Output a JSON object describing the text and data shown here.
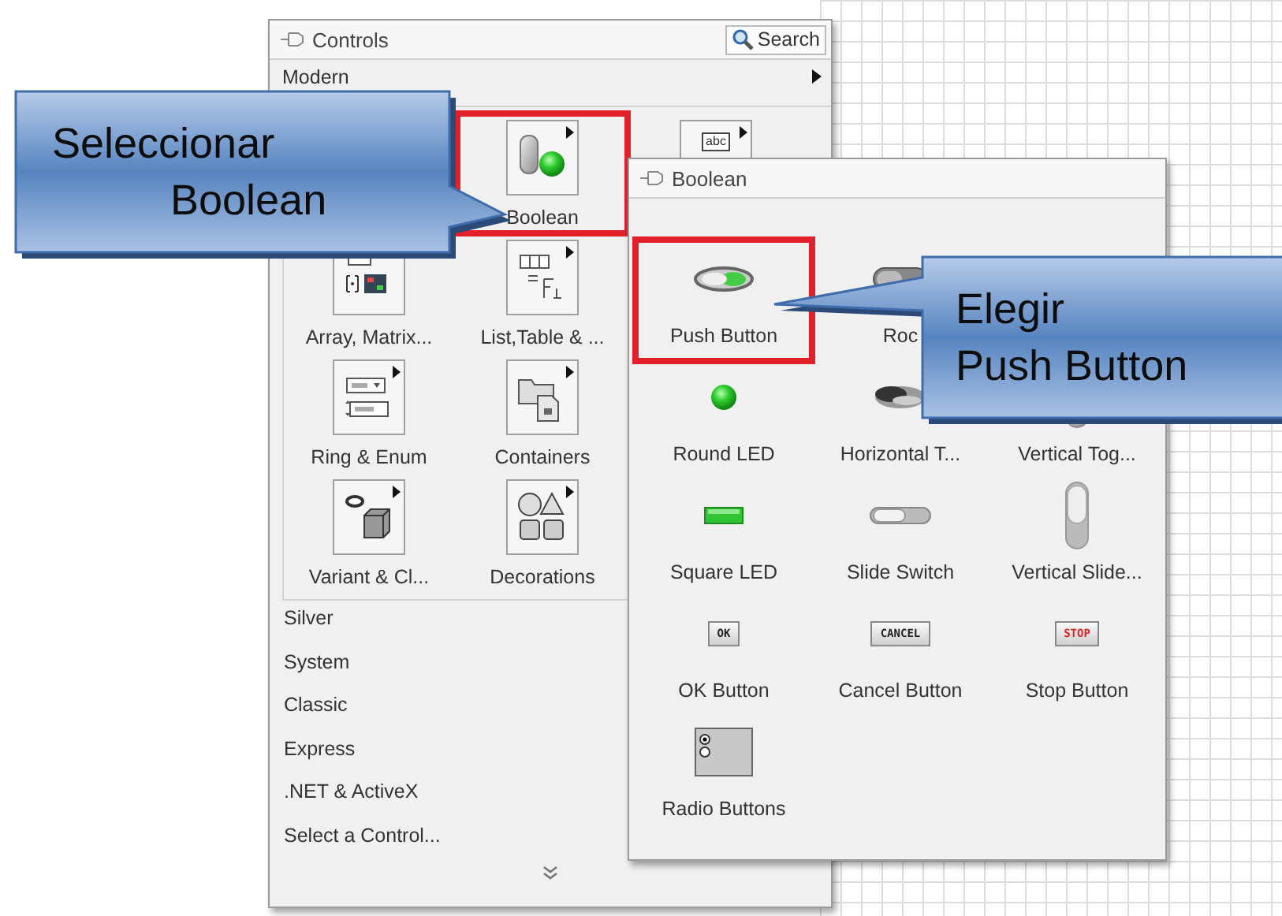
{
  "controls_palette": {
    "title": "Controls",
    "search_button": "Search",
    "category": "Modern",
    "rows": [
      [
        "",
        {
          "kind": "boolean",
          "label": "Boolean",
          "highlighted": true
        },
        {
          "kind": "string",
          "icon_text": "abc",
          "highlighted": false
        }
      ],
      [
        {
          "kind": "array",
          "label": "Array, Matrix...",
          "highlighted": false
        },
        {
          "kind": "list_table",
          "label": "List,Table & ...",
          "highlighted": false
        }
      ],
      [
        {
          "kind": "ring_enum",
          "label": "Ring & Enum",
          "highlighted": false
        },
        {
          "kind": "containers",
          "label": "Containers",
          "highlighted": false
        }
      ],
      [
        {
          "kind": "variant_class",
          "label": "Variant & Cl...",
          "highlighted": false
        },
        {
          "kind": "decorations",
          "label": "Decorations",
          "highlighted": false
        }
      ]
    ],
    "categories": [
      "Silver",
      "System",
      "Classic",
      "Express",
      ".NET & ActiveX",
      "Select a Control..."
    ]
  },
  "boolean_palette": {
    "title": "Boolean",
    "rows": [
      [
        {
          "kind": "push_button",
          "label": "Push Button",
          "highlighted": true
        },
        {
          "kind": "rocker",
          "label": "Roc",
          "highlighted": false
        }
      ],
      [
        {
          "kind": "round_led",
          "label": "Round LED",
          "highlighted": false
        },
        {
          "kind": "horizontal_toggle",
          "label": "Horizontal T...",
          "highlighted": false
        },
        {
          "kind": "vertical_toggle",
          "label": "Vertical Tog...",
          "highlighted": false
        }
      ],
      [
        {
          "kind": "square_led",
          "label": "Square LED",
          "highlighted": false
        },
        {
          "kind": "slide_switch",
          "label": "Slide Switch",
          "highlighted": false
        },
        {
          "kind": "vertical_slide",
          "label": "Vertical Slide...",
          "highlighted": false
        }
      ],
      [
        {
          "kind": "ok_button",
          "icon_text": "OK",
          "label": "OK Button",
          "highlighted": false
        },
        {
          "kind": "cancel_button",
          "icon_text": "CANCEL",
          "label": "Cancel Button",
          "highlighted": false
        },
        {
          "kind": "stop_button",
          "icon_text": "STOP",
          "label": "Stop Button",
          "highlighted": false
        }
      ],
      [
        {
          "kind": "radio_buttons",
          "label": "Radio Buttons",
          "highlighted": false
        }
      ]
    ]
  },
  "callouts": [
    {
      "lines": [
        "Seleccionar",
        "Boolean"
      ]
    },
    {
      "lines": [
        "Elegir",
        "Push Button"
      ]
    }
  ]
}
